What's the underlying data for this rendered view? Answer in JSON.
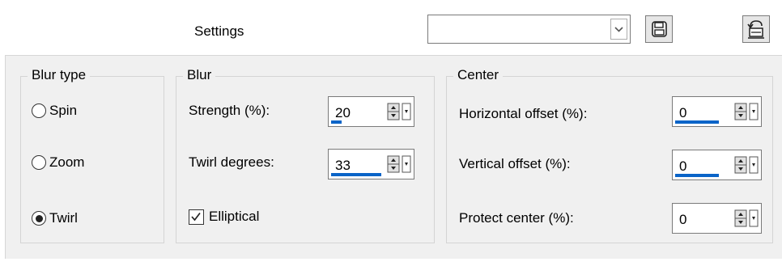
{
  "toolbar": {
    "settings_label": "Settings",
    "preset_value": "",
    "save_icon": "save-icon",
    "reset_icon": "reset-defaults-icon"
  },
  "blur_type": {
    "title": "Blur type",
    "options": [
      {
        "label": "Spin",
        "selected": false
      },
      {
        "label": "Zoom",
        "selected": false
      },
      {
        "label": "Twirl",
        "selected": true
      }
    ]
  },
  "blur": {
    "title": "Blur",
    "strength_label": "Strength (%):",
    "strength_value": "20",
    "strength_fraction": 0.2,
    "twirl_label": "Twirl degrees:",
    "twirl_value": "33",
    "twirl_fraction": 0.92,
    "elliptical_label": "Elliptical",
    "elliptical_checked": true
  },
  "center": {
    "title": "Center",
    "horizontal_label": "Horizontal offset (%):",
    "horizontal_value": "0",
    "vertical_label": "Vertical offset (%):",
    "vertical_value": "0",
    "protect_label": "Protect center (%):",
    "protect_value": "0"
  },
  "colors": {
    "accent": "#0a64c8",
    "panel_bg": "#f0f0f0"
  }
}
